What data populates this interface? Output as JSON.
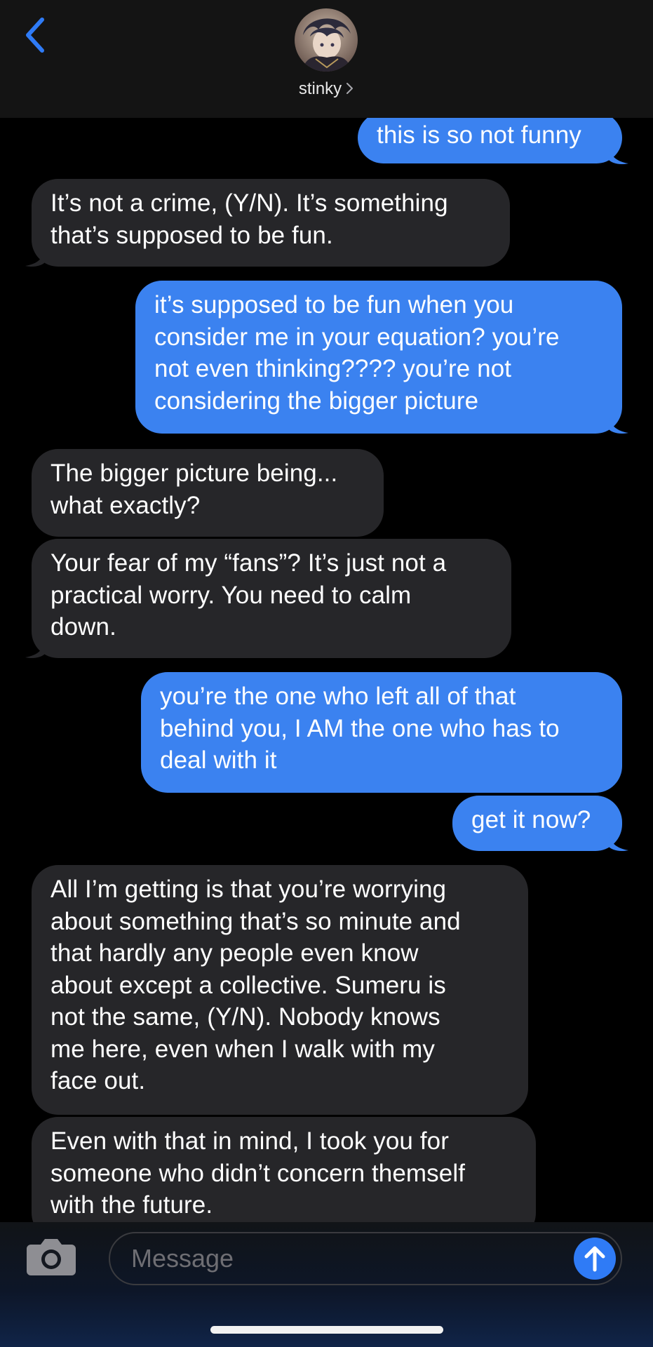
{
  "header": {
    "contact_name": "stinky",
    "back_icon": "chevron-left-icon",
    "chevron_icon": "chevron-right-icon",
    "accent_color": "#2f7bf6"
  },
  "messages": [
    {
      "direction": "outgoing",
      "text": "this is so not funny"
    },
    {
      "direction": "incoming",
      "text": "It’s not a crime, (Y/N). It’s something\nthat’s supposed to be fun."
    },
    {
      "direction": "outgoing",
      "text": "it’s supposed to be fun when you\nconsider me in your equation? you’re\nnot even thinking???? you’re not\nconsidering the bigger picture"
    },
    {
      "direction": "incoming",
      "text": "The bigger picture being...\nwhat exactly?"
    },
    {
      "direction": "incoming",
      "text": "Your fear of my “fans”? It’s just not a\npractical worry. You need to calm\ndown."
    },
    {
      "direction": "outgoing",
      "text": "you’re the one who left all of that\nbehind you, I AM the one who has to\ndeal with it"
    },
    {
      "direction": "outgoing",
      "text": "get it now?"
    },
    {
      "direction": "incoming",
      "text": "All I’m getting is that you’re worrying\nabout something that’s so minute and\nthat hardly any people even know\nabout except a collective. Sumeru is\nnot the same, (Y/N). Nobody knows\nme here, even when I walk with my\nface out."
    },
    {
      "direction": "incoming",
      "text": "Even with that in mind, I took you for\nsomeone who didn’t concern themself\nwith the future."
    }
  ],
  "composer": {
    "placeholder": "Message",
    "value": "",
    "camera_icon": "camera-icon",
    "send_icon": "arrow-up-icon"
  },
  "colors": {
    "incoming_bubble": "#262629",
    "outgoing_bubble": "#3b82f0",
    "background": "#000000"
  }
}
